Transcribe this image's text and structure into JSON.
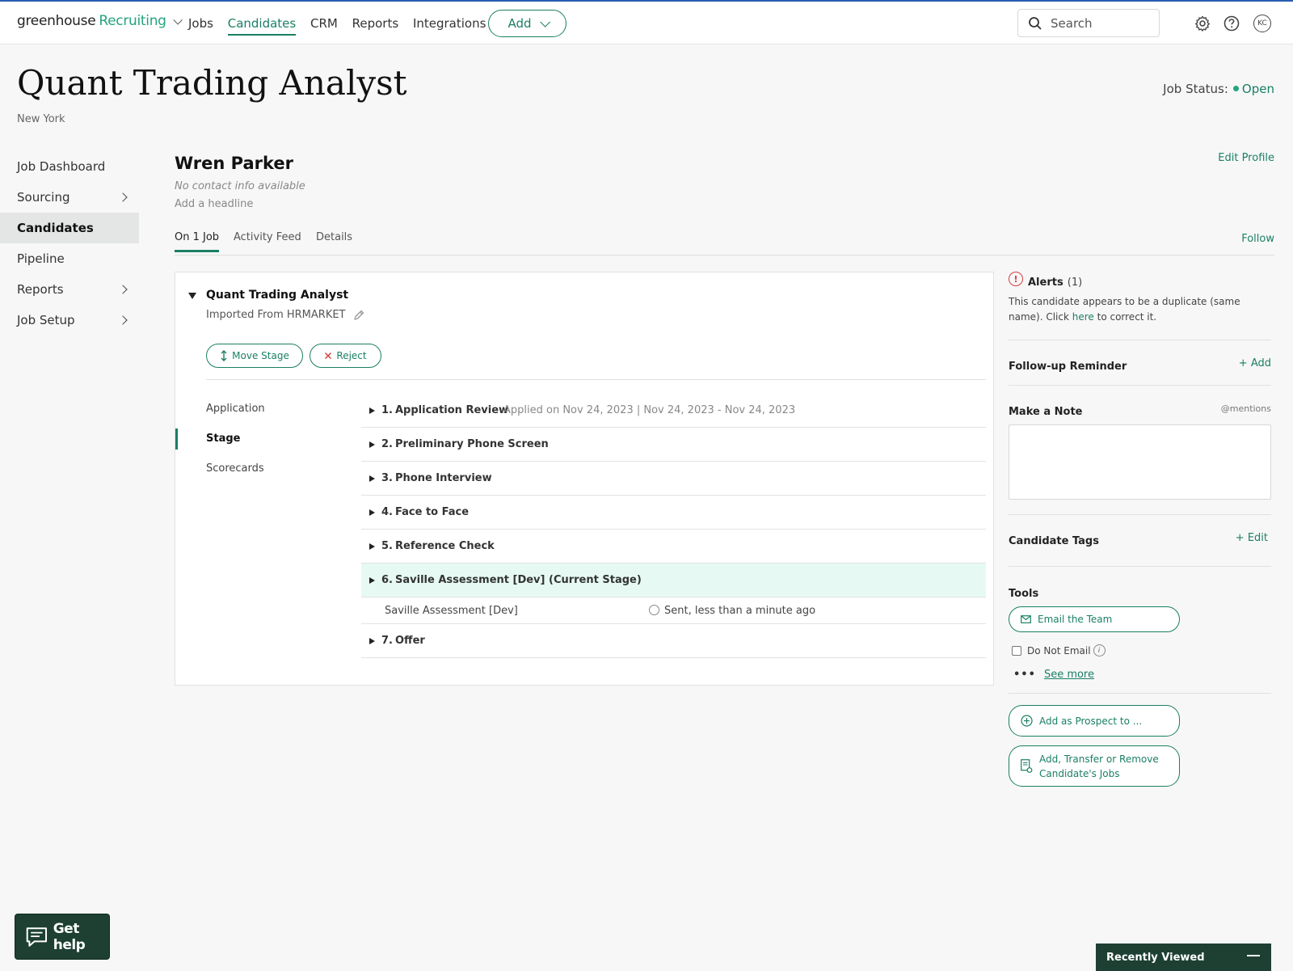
{
  "topnav": {
    "brand_main": "greenhouse",
    "brand_product": "Recruiting",
    "links": [
      "Jobs",
      "Candidates",
      "CRM",
      "Reports",
      "Integrations"
    ],
    "active_link": "Candidates",
    "add_label": "Add",
    "search_placeholder": "Search",
    "avatar_initials": "KC"
  },
  "job": {
    "title": "Quant Trading Analyst",
    "location": "New York",
    "status_label": "Job Status:",
    "status_value": "Open",
    "status_color": "#24a47f"
  },
  "sidebar": {
    "items": [
      {
        "label": "Job Dashboard",
        "has_chevron": false
      },
      {
        "label": "Sourcing",
        "has_chevron": true
      },
      {
        "label": "Candidates",
        "has_chevron": false,
        "active": true
      },
      {
        "label": "Pipeline",
        "has_chevron": false
      },
      {
        "label": "Reports",
        "has_chevron": true
      },
      {
        "label": "Job Setup",
        "has_chevron": true
      }
    ]
  },
  "candidate": {
    "name": "Wren Parker",
    "contact": "No contact info available",
    "headline": "Add a headline",
    "edit_profile": "Edit Profile",
    "follow": "Follow",
    "tabs": [
      "On 1 Job",
      "Activity Feed",
      "Details"
    ]
  },
  "job_card": {
    "title": "Quant Trading Analyst",
    "imported": "Imported From HRMARKET",
    "move_stage": "Move Stage",
    "reject": "Reject",
    "subnav": [
      "Application",
      "Stage",
      "Scorecards"
    ],
    "stages": [
      {
        "num": "1.",
        "name": "Application Review",
        "applied": "Applied on Nov 24, 2023 | Nov 24, 2023 - Nov 24, 2023"
      },
      {
        "num": "2.",
        "name": "Preliminary Phone Screen"
      },
      {
        "num": "3.",
        "name": "Phone Interview"
      },
      {
        "num": "4.",
        "name": "Face to Face"
      },
      {
        "num": "5.",
        "name": "Reference Check"
      },
      {
        "num": "6.",
        "name": "Saville Assessment [Dev] (Current Stage)",
        "current": true
      },
      {
        "num": "7.",
        "name": "Offer"
      }
    ],
    "current_stage_sub": {
      "name": "Saville Assessment [Dev]",
      "status": "Sent, less than a minute ago"
    }
  },
  "right_panel": {
    "alerts_label": "Alerts",
    "alerts_count": "(1)",
    "alert_text_before": "This candidate appears to be a duplicate (same name). Click ",
    "alert_link": "here",
    "alert_text_after": " to correct it.",
    "followup_label": "Follow-up Reminder",
    "followup_add": "+ Add",
    "note_label": "Make a Note",
    "note_mentions": "@mentions",
    "tags_label": "Candidate Tags",
    "tags_edit": "+ Edit",
    "tools_label": "Tools",
    "email_team": "Email the Team",
    "do_not_email": "Do Not Email",
    "info_glyph": "i",
    "see_more": "See more",
    "add_prospect": "Add as Prospect to ...",
    "transfer_line1": "Add, Transfer or Remove",
    "transfer_line2": "Candidate's Jobs"
  },
  "widgets": {
    "get_help": "Get help",
    "recently_viewed": "Recently Viewed"
  }
}
